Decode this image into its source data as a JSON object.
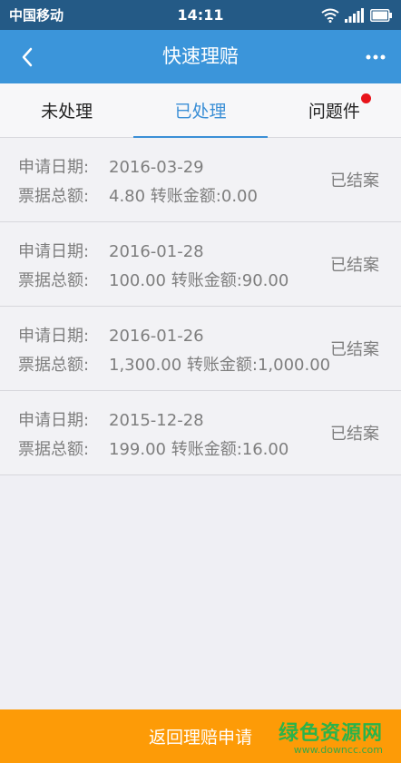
{
  "statusbar": {
    "carrier": "中国移动",
    "time": "14:11"
  },
  "navbar": {
    "title": "快速理赔"
  },
  "tabs": [
    {
      "label": "未处理",
      "active": false
    },
    {
      "label": "已处理",
      "active": true
    },
    {
      "label": "问题件",
      "active": false,
      "badge": true
    }
  ],
  "claims": [
    {
      "date_label": "申请日期:",
      "date": "2016-03-29",
      "amount_label": "票据总额:",
      "amount": "4.80 转账金额:0.00",
      "status": "已结案"
    },
    {
      "date_label": "申请日期:",
      "date": "2016-01-28",
      "amount_label": "票据总额:",
      "amount": "100.00 转账金额:90.00",
      "status": "已结案"
    },
    {
      "date_label": "申请日期:",
      "date": "2016-01-26",
      "amount_label": "票据总额:",
      "amount": "1,300.00 转账金额:1,000.00",
      "status": "已结案"
    },
    {
      "date_label": "申请日期:",
      "date": "2015-12-28",
      "amount_label": "票据总额:",
      "amount": "199.00 转账金额:16.00",
      "status": "已结案"
    }
  ],
  "footer": {
    "button_label": "返回理赔申请"
  },
  "watermark": {
    "main": "绿色资源网",
    "sub": "www.downcc.com"
  },
  "colors": {
    "statusbar": "#245a86",
    "navbar": "#3b95da",
    "accent": "#3b8fd6",
    "badge": "#e8141b",
    "footer": "#fd9b07"
  }
}
